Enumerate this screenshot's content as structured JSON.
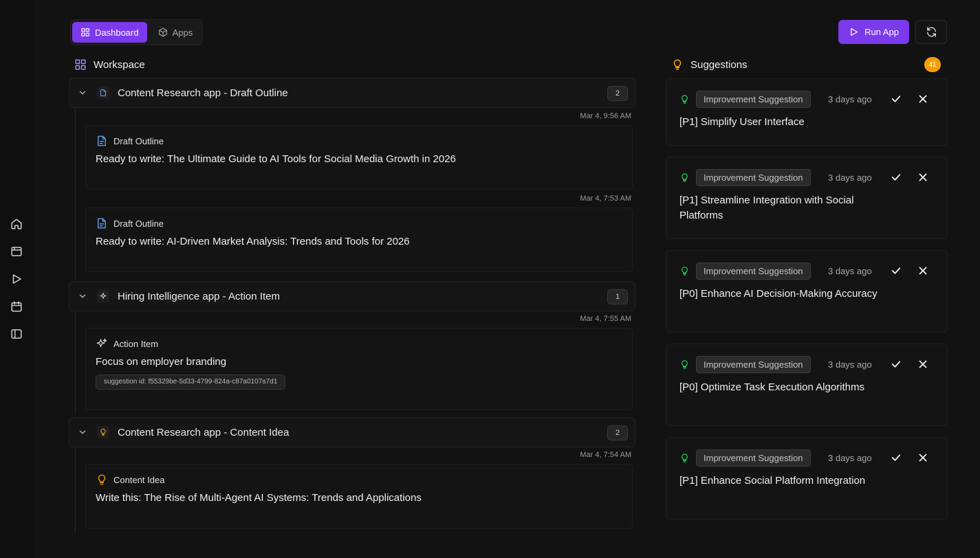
{
  "tabs": [
    {
      "label": "Dashboard",
      "active": true,
      "icon": "grid-icon"
    },
    {
      "label": "Apps",
      "active": false,
      "icon": "box-icon"
    }
  ],
  "run_button": {
    "label": "Run App"
  },
  "workspace": {
    "title": "Workspace",
    "groups": [
      {
        "title": "Content Research app - Draft Outline",
        "count": "2",
        "icon": "document-icon",
        "items": [
          {
            "timestamp": "Mar 4, 9:56 AM",
            "type": "Draft Outline",
            "text": "Ready to write: The Ultimate Guide to AI Tools for Social Media Growth in 2026"
          },
          {
            "timestamp": "Mar 4, 7:53 AM",
            "type": "Draft Outline",
            "text": "Ready to write: AI-Driven Market Analysis: Trends and Tools for 2026"
          }
        ]
      },
      {
        "title": "Hiring Intelligence app - Action Item",
        "count": "1",
        "icon": "sparkle-icon",
        "items": [
          {
            "timestamp": "Mar 4, 7:55 AM",
            "type": "Action Item",
            "text": "Focus on employer branding",
            "suggestion_id": "suggestion id: f55329be-5d33-4799-824a-c87a0107a7d1"
          }
        ]
      },
      {
        "title": "Content Research app - Content Idea",
        "count": "2",
        "icon": "lightbulb-icon",
        "items": [
          {
            "timestamp": "Mar 4, 7:54 AM",
            "type": "Content Idea",
            "text": "Write this: The Rise of Multi-Agent AI Systems: Trends and Applications"
          }
        ]
      }
    ]
  },
  "suggestions": {
    "title": "Suggestions",
    "count": "41",
    "items": [
      {
        "type": "Improvement Suggestion",
        "age": "3 days ago",
        "title": "[P1] Simplify User Interface"
      },
      {
        "type": "Improvement Suggestion",
        "age": "3 days ago",
        "title": "[P1] Streamline Integration with Social Platforms"
      },
      {
        "type": "Improvement Suggestion",
        "age": "3 days ago",
        "title": "[P0] Enhance AI Decision-Making Accuracy"
      },
      {
        "type": "Improvement Suggestion",
        "age": "3 days ago",
        "title": "[P0] Optimize Task Execution Algorithms"
      },
      {
        "type": "Improvement Suggestion",
        "age": "3 days ago",
        "title": "[P1] Enhance Social Platform Integration"
      }
    ]
  },
  "colors": {
    "accent": "#7c3aed",
    "warning": "#f59e0b",
    "success": "#22c55e",
    "info": "#60a5fa"
  }
}
